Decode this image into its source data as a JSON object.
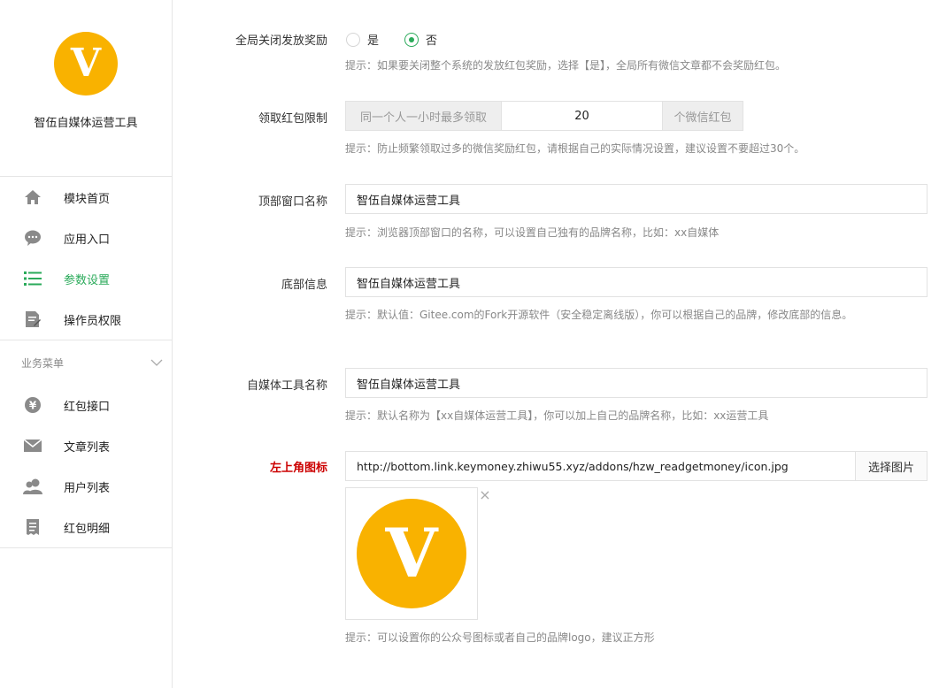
{
  "sidebar": {
    "brand_name": "智伍自媒体运营工具",
    "logo_letter": "V",
    "items": [
      {
        "label": "模块首页",
        "icon": "home-icon"
      },
      {
        "label": "应用入口",
        "icon": "chat-bubble-icon"
      },
      {
        "label": "参数设置",
        "icon": "list-icon",
        "active": true
      },
      {
        "label": "操作员权限",
        "icon": "edit-document-icon"
      }
    ],
    "section_title": "业务菜单",
    "business_items": [
      {
        "label": "红包接口",
        "icon": "yen-coin-icon"
      },
      {
        "label": "文章列表",
        "icon": "envelope-icon"
      },
      {
        "label": "用户列表",
        "icon": "users-icon"
      },
      {
        "label": "红包明细",
        "icon": "receipt-icon"
      }
    ]
  },
  "form": {
    "global_close": {
      "label": "全局关闭发放奖励",
      "option_yes": "是",
      "option_no": "否",
      "selected": "否",
      "hint": "提示：如果要关闭整个系统的发放红包奖励，选择【是】，全局所有微信文章都不会奖励红包。"
    },
    "limit": {
      "label": "领取红包限制",
      "prefix": "同一个人一小时最多领取",
      "value": "20",
      "suffix": "个微信红包",
      "hint": "提示：防止频繁领取过多的微信奖励红包，请根据自己的实际情况设置，建议设置不要超过30个。"
    },
    "window_title": {
      "label": "顶部窗口名称",
      "value": "智伍自媒体运营工具",
      "hint": "提示：浏览器顶部窗口的名称，可以设置自己独有的品牌名称，比如：xx自媒体"
    },
    "footer": {
      "label": "底部信息",
      "value": "智伍自媒体运营工具",
      "hint": "提示：默认值：Gitee.com的Fork开源软件（安全稳定离线版），你可以根据自己的品牌，修改底部的信息。"
    },
    "tool_name": {
      "label": "自媒体工具名称",
      "value": "智伍自媒体运营工具",
      "hint": "提示：默认名称为【xx自媒体运营工具】，你可以加上自己的品牌名称，比如：xx运营工具"
    },
    "logo": {
      "label": "左上角图标",
      "value": "http://bottom.link.keymoney.zhiwu55.xyz/addons/hzw_readgetmoney/icon.jpg",
      "button": "选择图片",
      "close": "×",
      "hint": "提示：可以设置你的公众号图标或者自己的品牌logo，建议正方形"
    }
  },
  "colors": {
    "accent_green": "#2aaa5a",
    "logo_orange": "#f9b200",
    "required_red": "#cc0000"
  }
}
